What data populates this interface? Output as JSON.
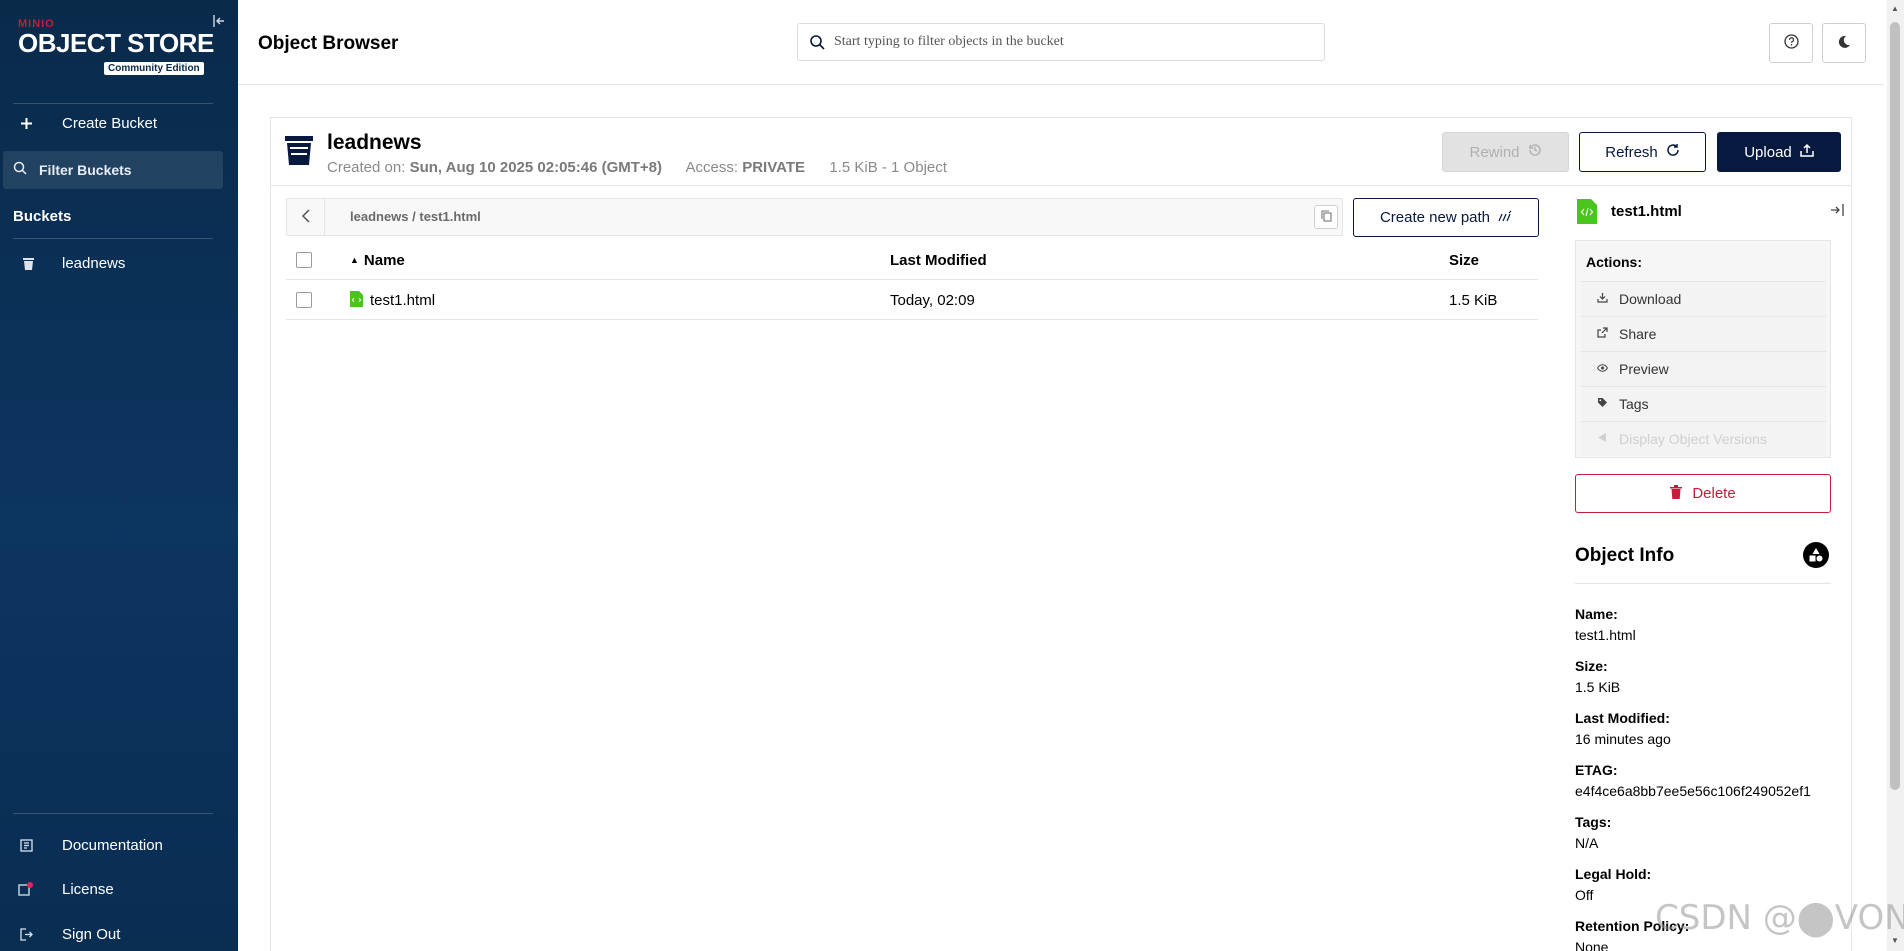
{
  "sidebar": {
    "logo_brand": "MINIO",
    "logo_main": "OBJECT STORE",
    "logo_edition": "Community Edition",
    "create_bucket": "Create Bucket",
    "filter_buckets": "Filter Buckets",
    "buckets_section": "Buckets",
    "buckets": [
      {
        "name": "leadnews"
      }
    ],
    "documentation": "Documentation",
    "license": "License",
    "sign_out": "Sign Out"
  },
  "header": {
    "title": "Object Browser",
    "search_placeholder": "Start typing to filter objects in the bucket"
  },
  "bucket": {
    "name": "leadnews",
    "created_label": "Created on:",
    "created_value": "Sun, Aug 10 2025 02:05:46 (GMT+8)",
    "access_label": "Access:",
    "access_value": "PRIVATE",
    "summary": "1.5 KiB - 1 Object",
    "rewind_label": "Rewind",
    "refresh_label": "Refresh",
    "upload_label": "Upload"
  },
  "breadcrumb": {
    "path": "leadnews  /  test1.html",
    "create_new_path": "Create new path"
  },
  "table": {
    "columns": {
      "name": "Name",
      "last_modified": "Last Modified",
      "size": "Size"
    },
    "rows": [
      {
        "name": "test1.html",
        "last_modified": "Today, 02:09",
        "size": "1.5 KiB"
      }
    ]
  },
  "detail": {
    "file_name": "test1.html",
    "actions_title": "Actions:",
    "actions": {
      "download": "Download",
      "share": "Share",
      "preview": "Preview",
      "tags": "Tags",
      "versions": "Display Object Versions"
    },
    "delete_label": "Delete",
    "info_title": "Object Info",
    "info": {
      "name_label": "Name:",
      "name_value": "test1.html",
      "size_label": "Size:",
      "size_value": "1.5 KiB",
      "modified_label": "Last Modified:",
      "modified_value": "16 minutes ago",
      "etag_label": "ETAG:",
      "etag_value": "e4f4ce6a8bb7ee5e56c106f249052ef1",
      "tags_label": "Tags:",
      "tags_value": "N/A",
      "legal_label": "Legal Hold:",
      "legal_value": "Off",
      "retention_label": "Retention Policy:",
      "retention_value": "None"
    }
  },
  "watermark": "CSDN @⬤VON",
  "colors": {
    "sidebar": "#0c3560",
    "primary": "#07193e",
    "danger": "#c51b3c",
    "file_green": "#4cc41f"
  }
}
